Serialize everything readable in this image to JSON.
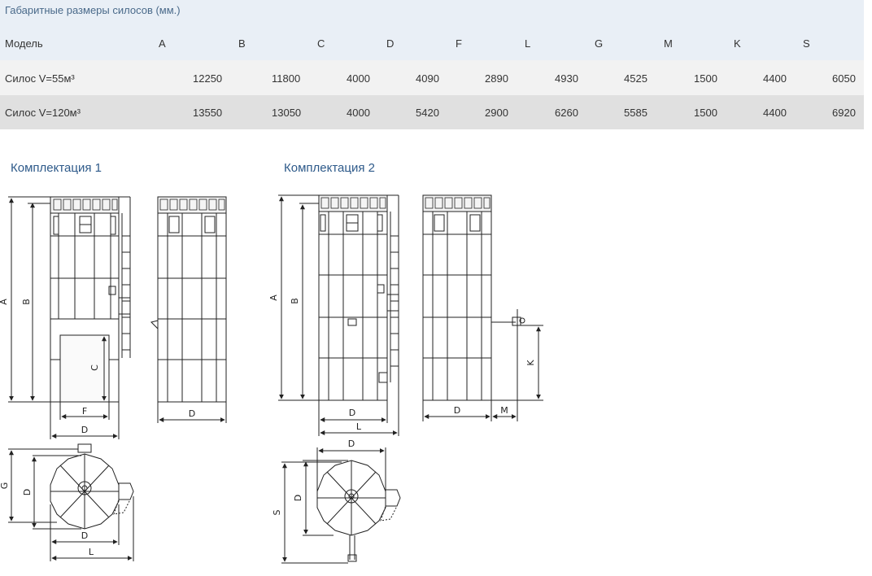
{
  "table": {
    "caption": "Габаритные размеры силосов (мм.)",
    "header": [
      "Модель",
      "A",
      "B",
      "C",
      "D",
      "F",
      "L",
      "G",
      "M",
      "K",
      "S"
    ],
    "rows": [
      {
        "model": "Силос V=55м³",
        "values": [
          "12250",
          "11800",
          "4000",
          "4090",
          "2890",
          "4930",
          "4525",
          "1500",
          "4400",
          "6050"
        ]
      },
      {
        "model": "Силос V=120м³",
        "values": [
          "13550",
          "13050",
          "4000",
          "5420",
          "2900",
          "6260",
          "5585",
          "1500",
          "4400",
          "6920"
        ]
      }
    ]
  },
  "kit1": {
    "title": "Комплектация 1",
    "front_labels": {
      "a": "A",
      "b": "B",
      "c": "C",
      "f": "F",
      "d": "D"
    },
    "side_labels": {
      "d": "D"
    },
    "plan_labels": {
      "g": "G",
      "d_v": "D",
      "d_h": "D",
      "l": "L"
    }
  },
  "kit2": {
    "title": "Комплектация 2",
    "front_labels": {
      "a": "A",
      "b": "B",
      "d": "D",
      "l": "L"
    },
    "side_labels": {
      "d": "D",
      "m": "M",
      "k": "K"
    },
    "plan_labels": {
      "s": "S",
      "d_v": "D",
      "d_h": "D"
    }
  }
}
